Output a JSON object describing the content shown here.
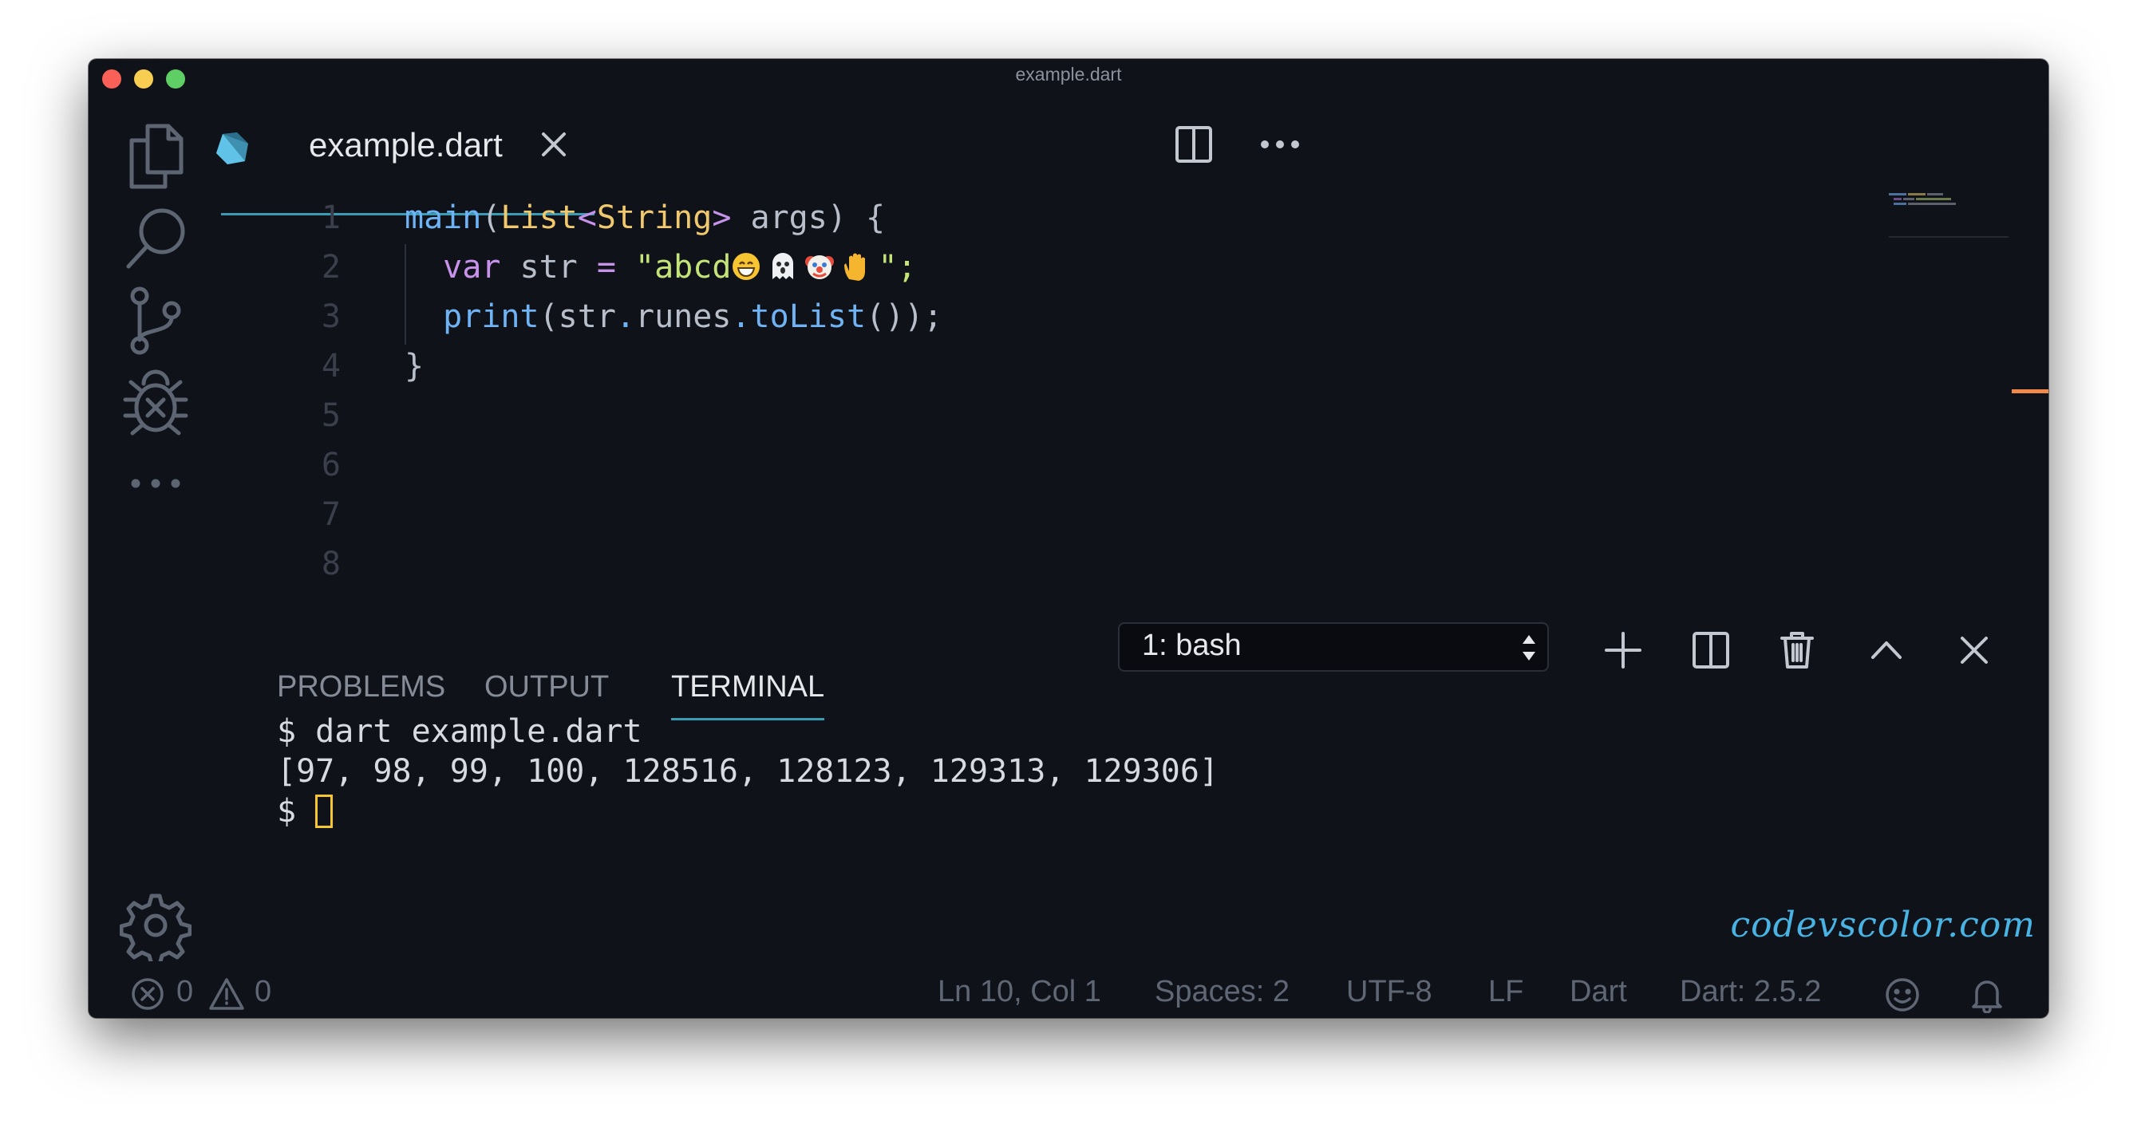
{
  "window": {
    "title": "example.dart"
  },
  "activity_bar": {
    "items": [
      "files-icon",
      "search-icon",
      "source-control-icon",
      "debug-icon",
      "more-icon",
      "settings-icon"
    ]
  },
  "editor": {
    "tab": {
      "label": "example.dart",
      "icon": "dart-icon"
    },
    "line_numbers": [
      "1",
      "2",
      "3",
      "4",
      "5",
      "6",
      "7",
      "8"
    ],
    "code": {
      "line1": {
        "fn": "main",
        "open": "(",
        "type1": "List",
        "lt": "<",
        "type2": "String",
        "gt": ">",
        "rest": " args) {"
      },
      "line2": {
        "kw": "var",
        "name": " str ",
        "op": "=",
        "str": " \"abcd",
        "emojis": "😄👻🤡✋",
        "end": "\";"
      },
      "line3": {
        "fn": "print",
        "p1": "(str",
        "dot1": ".",
        "runes": "runes",
        "dot2": ".",
        "tolist": "toList",
        "end": "());"
      },
      "line4": {
        "close": "}"
      }
    }
  },
  "panel": {
    "tabs": [
      "PROBLEMS",
      "OUTPUT",
      "TERMINAL"
    ],
    "active_tab": "TERMINAL",
    "terminal_select": "1: bash",
    "terminal_lines": [
      "$ dart example.dart",
      "[97, 98, 99, 100, 128516, 128123, 129313, 129306]",
      "$ "
    ]
  },
  "watermark": "codevscolor.com",
  "status_bar": {
    "errors": "0",
    "warnings": "0",
    "position": "Ln 10, Col 1",
    "spaces": "Spaces: 2",
    "encoding": "UTF-8",
    "eol": "LF",
    "language": "Dart",
    "sdk": "Dart: 2.5.2"
  },
  "colors": {
    "background": "#0f1219",
    "accent": "#3a9bb4",
    "cursor": "#f7c531",
    "watermark": "#49b3e3"
  }
}
